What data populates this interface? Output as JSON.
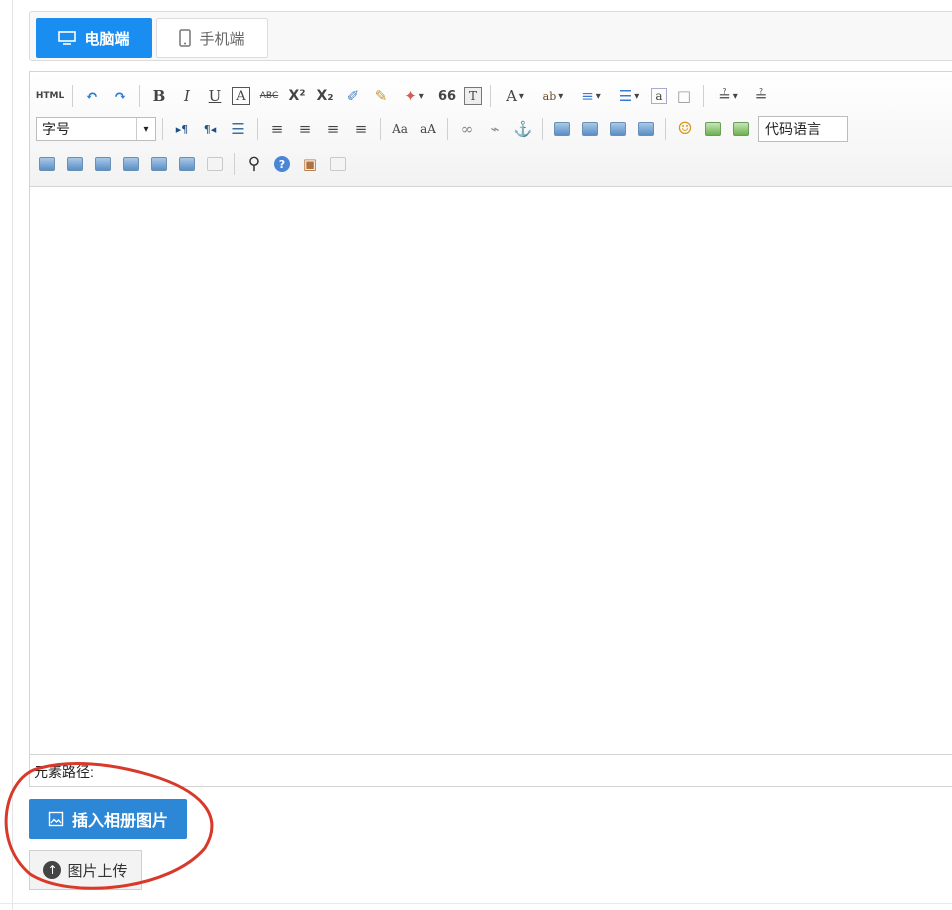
{
  "device_tabs": [
    {
      "label": "电脑端",
      "icon": "monitor-icon",
      "active": true
    },
    {
      "label": "手机端",
      "icon": "mobile-phone-icon",
      "active": false
    }
  ],
  "toolbar": {
    "row1": {
      "html": "HTML",
      "undo": "↶",
      "redo": "↷",
      "bold": "B",
      "italic": "I",
      "underline": "U",
      "fontborder": "A",
      "strikethrough": "ABC",
      "superscript": "X²",
      "subscript": "X₂",
      "removeformat": "✐",
      "formatmatch": "✎",
      "autotypeset": "✦",
      "blockquote": "66",
      "pasteplain": "T",
      "forecolor": "A",
      "backcolor": "ab",
      "orderedlist": "≡",
      "unorderedlist": "☰",
      "selectall": "a",
      "cleardoc": "□",
      "rowspacingtop": "≟",
      "rowspacingbottom": "≟"
    },
    "row2": {
      "fontsize_label": "字号",
      "ltr": "▸¶",
      "rtl": "¶◂",
      "indent": "☰",
      "justifyleft": "≡",
      "justifycenter": "≡",
      "justifyright": "≡",
      "justifyjustify": "≡",
      "touppercase": "Aa",
      "tolowercase": "aA",
      "link": "∞",
      "unlink": "⌁",
      "anchor": "⚓",
      "emotion": "☺",
      "code_language_label": "代码语言"
    },
    "row3": {
      "search": "⚲",
      "help": "?",
      "paste": "▣"
    }
  },
  "path_label": "元素路径:",
  "insert_album_button": "插入相册图片",
  "upload_button": "图片上传",
  "upload_icon": "↑",
  "colors": {
    "primary": "#1a8df0",
    "button_blue": "#2c87d6",
    "annotation": "#d8392a"
  }
}
